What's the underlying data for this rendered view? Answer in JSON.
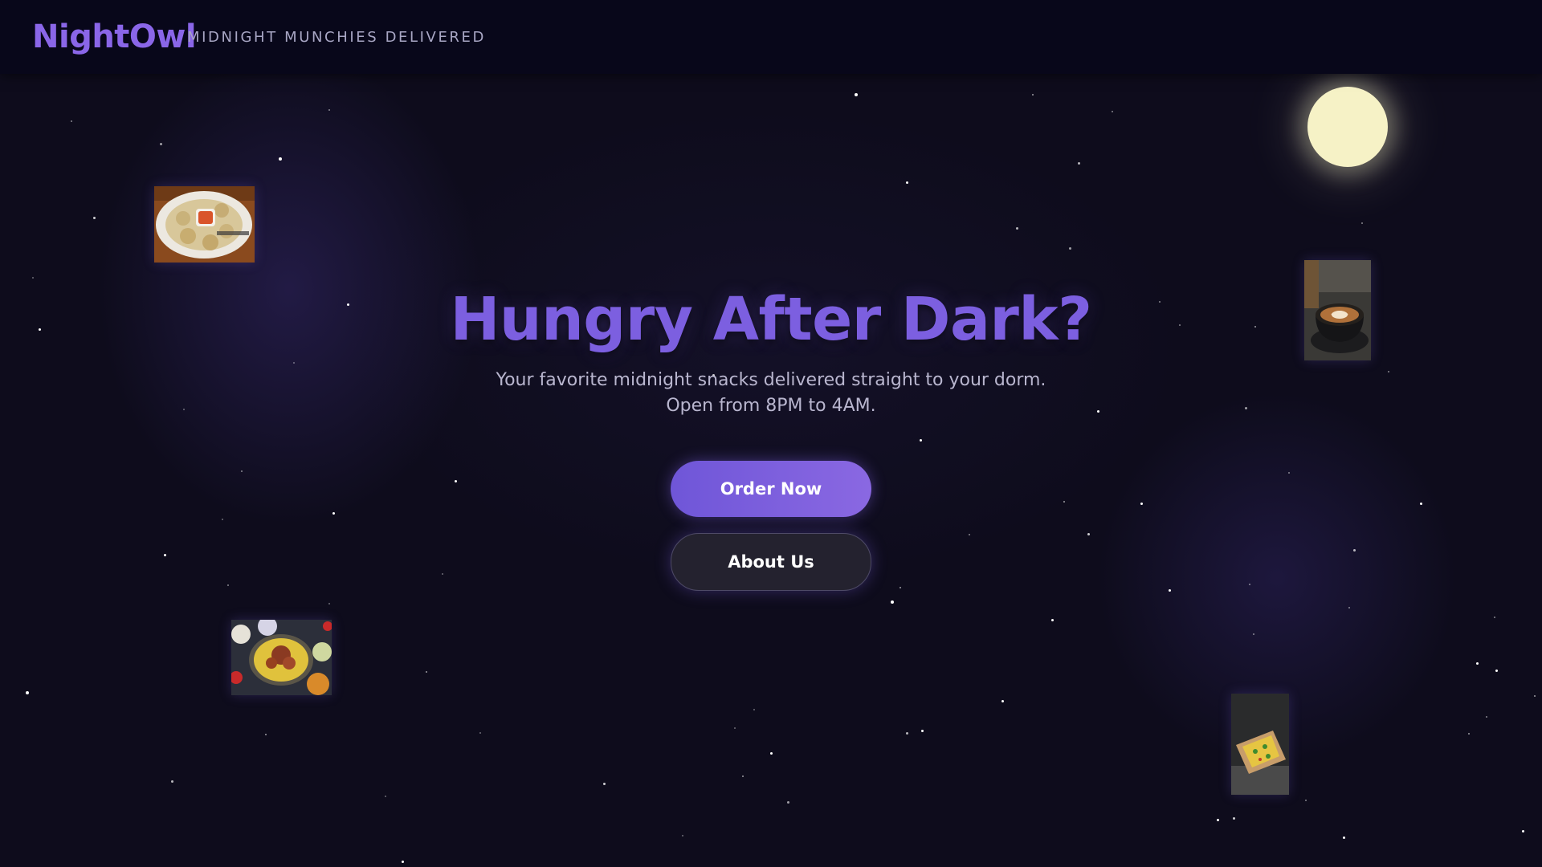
{
  "brand": {
    "name": "NightOwl",
    "tagline": "MIDNIGHT MUNCHIES DELIVERED"
  },
  "hero": {
    "title": "Hungry After Dark?",
    "subtitle": "Your favorite midnight snacks delivered straight to your dorm. Open from 8PM to 4AM."
  },
  "buttons": {
    "order_label": "Order Now",
    "about_label": "About Us"
  },
  "colors": {
    "background": "#0e0c1c",
    "header": "#08071a",
    "accent": "#7c5fe0",
    "moon": "#f6f2c6",
    "secondary_button": "#24222f"
  },
  "decorations": {
    "food_images": [
      "momos-plate",
      "latte-cup",
      "biryani-plate",
      "loaded-fries"
    ],
    "moon": "moon-icon"
  }
}
